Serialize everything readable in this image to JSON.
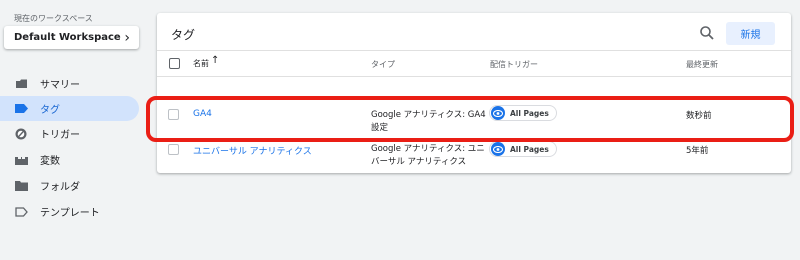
{
  "sidebar": {
    "workspace_label": "現在のワークスペース",
    "workspace_name": "Default Workspace",
    "items": [
      {
        "label": "サマリー",
        "icon": "summary-icon",
        "active": false
      },
      {
        "label": "タグ",
        "icon": "tag-icon",
        "active": true
      },
      {
        "label": "トリガー",
        "icon": "trigger-icon",
        "active": false
      },
      {
        "label": "変数",
        "icon": "variables-icon",
        "active": false
      },
      {
        "label": "フォルダ",
        "icon": "folder-icon",
        "active": false
      },
      {
        "label": "テンプレート",
        "icon": "template-icon",
        "active": false
      }
    ]
  },
  "main": {
    "title": "タグ",
    "new_button": "新規",
    "columns": {
      "name": "名前",
      "type": "タイプ",
      "trigger": "配信トリガー",
      "updated": "最終更新"
    },
    "rows": [
      {
        "name": "GA4",
        "type": "Google アナリティクス: GA4 設定",
        "trigger": "All Pages",
        "updated": "数秒前",
        "highlighted": true
      },
      {
        "name": "ユニバーサル アナリティクス",
        "type": "Google アナリティクス: ユニバーサル アナリティクス",
        "trigger": "All Pages",
        "updated": "5年前",
        "highlighted": false
      }
    ]
  },
  "colors": {
    "accent": "#1a73e8",
    "active_nav_bg": "#d2e3fc",
    "highlight_border": "#ea1e15",
    "background": "#f1f3f4"
  }
}
